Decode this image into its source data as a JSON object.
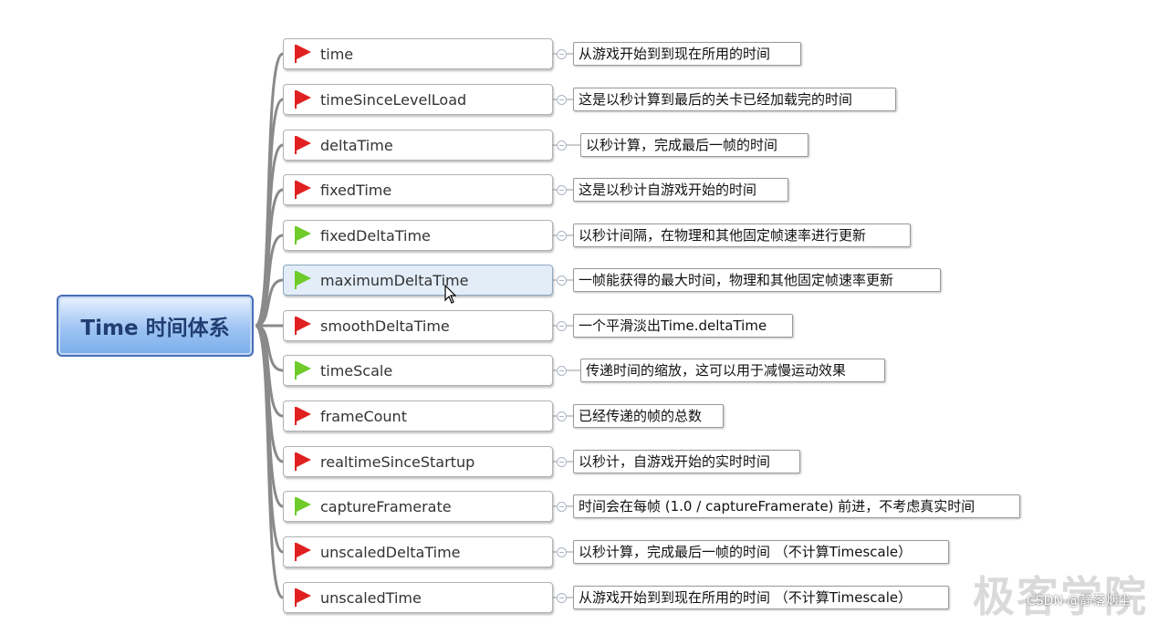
{
  "root": {
    "title": "Time 时间体系"
  },
  "colors": {
    "flag_red": "#e02020",
    "flag_green": "#6ecb2a",
    "branch": "#8a8a8a",
    "root_border": "#4a6fb8"
  },
  "nodes": [
    {
      "label": "time",
      "desc": "从游戏开始到到现在所用的时间",
      "flag": "red-flag-icon"
    },
    {
      "label": "timeSinceLevelLoad",
      "desc": "这是以秒计算到最后的关卡已经加载完的时间",
      "flag": "red-flag-icon"
    },
    {
      "label": "deltaTime",
      "desc": "以秒计算，完成最后一帧的时间",
      "flag": "red-flag-icon"
    },
    {
      "label": "fixedTime",
      "desc": "这是以秒计自游戏开始的时间",
      "flag": "red-flag-icon"
    },
    {
      "label": "fixedDeltaTime",
      "desc": "以秒计间隔，在物理和其他固定帧速率进行更新",
      "flag": "green-flag-icon"
    },
    {
      "label": "maximumDeltaTime",
      "desc": "一帧能获得的最大时间，物理和其他固定帧速率更新",
      "flag": "green-flag-icon",
      "selected": true
    },
    {
      "label": "smoothDeltaTime",
      "desc": "一个平滑淡出Time.deltaTime",
      "flag": "red-flag-icon"
    },
    {
      "label": "timeScale",
      "desc": "传递时间的缩放，这可以用于减慢运动效果",
      "flag": "green-flag-icon"
    },
    {
      "label": "frameCount",
      "desc": "已经传递的帧的总数",
      "flag": "red-flag-icon"
    },
    {
      "label": "realtimeSinceStartup",
      "desc": "以秒计，自游戏开始的实时时间",
      "flag": "red-flag-icon"
    },
    {
      "label": "captureFramerate",
      "desc": "时间会在每帧 (1.0 / captureFramerate) 前进，不考虑真实时间",
      "flag": "green-flag-icon"
    },
    {
      "label": "unscaledDeltaTime",
      "desc": "以秒计算，完成最后一帧的时间 （不计算Timescale）",
      "flag": "red-flag-icon"
    },
    {
      "label": "unscaledTime",
      "desc": "从游戏开始到到现在所用的时间 （不计算Timescale）",
      "flag": "red-flag-icon"
    }
  ],
  "watermark": "极客学院",
  "credit": "CSDN @静落烟尘"
}
